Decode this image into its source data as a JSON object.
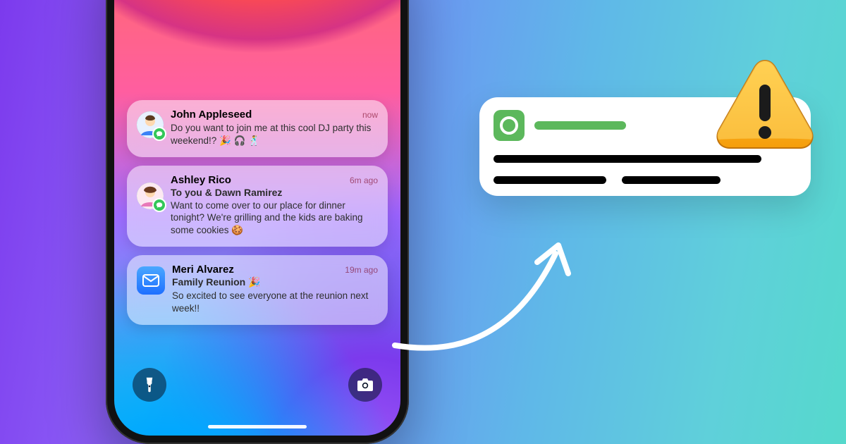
{
  "phone": {
    "notifications": [
      {
        "sender": "John Appleseed",
        "time": "now",
        "message": "Do you want to join me at this cool DJ party this weekend!? 🎉 🎧 🕺"
      },
      {
        "sender": "Ashley Rico",
        "subtitle": "To you & Dawn Ramirez",
        "time": "6m ago",
        "message": "Want to come over to our place for dinner tonight? We're grilling and the kids are baking some cookies 🍪"
      },
      {
        "sender": "Meri Alvarez",
        "subject": "Family Reunion 🎉",
        "time": "19m ago",
        "message": "So excited to see everyone at the reunion next week!!"
      }
    ]
  }
}
